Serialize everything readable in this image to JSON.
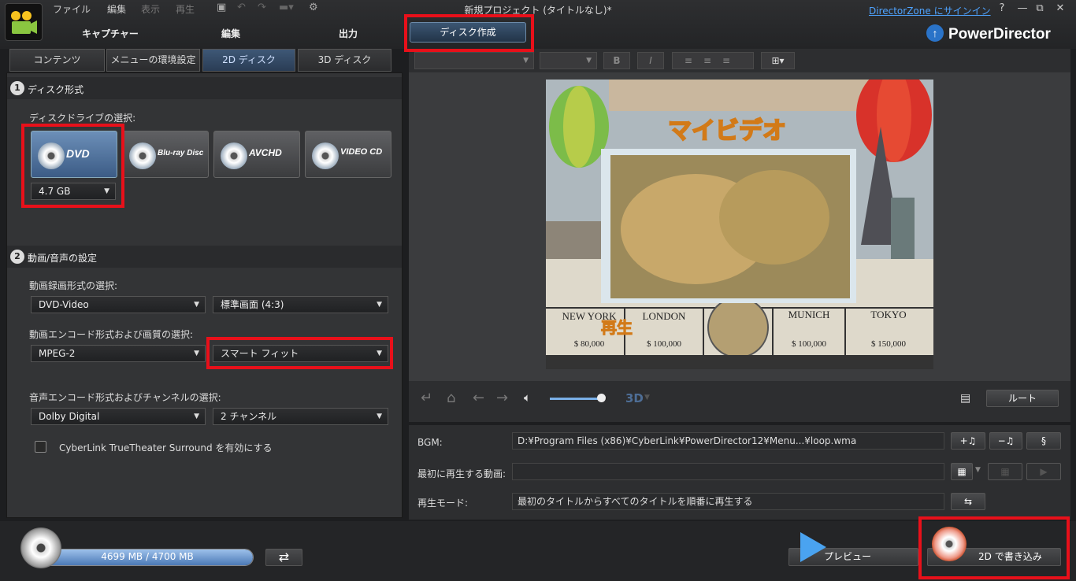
{
  "menu": {
    "file": "ファイル",
    "edit": "編集",
    "view": "表示",
    "play": "再生"
  },
  "window": {
    "title": "新規プロジェクト (タイトルなし)*",
    "signin": "DirectorZone にサインイン",
    "help": "?",
    "minimize": "—",
    "restore": "⧉",
    "close": "✕"
  },
  "modes": {
    "capture": "キャプチャー",
    "edit": "編集",
    "output": "出力",
    "disc": "ディスク作成"
  },
  "brand": "PowerDirector",
  "subtabs": [
    "コンテンツ",
    "メニューの環境設定",
    "2D ディスク",
    "3D ディスク"
  ],
  "section1": {
    "num": "1",
    "title": "ディスク形式",
    "drive_label": "ディスクドライブの選択:",
    "discs": [
      "DVD",
      "Blu-ray Disc",
      "AVCHD",
      "VIDEO CD"
    ],
    "size": "4.7 GB"
  },
  "section2": {
    "num": "2",
    "title": "動画/音声の設定",
    "rec_label": "動画録画形式の選択:",
    "rec_format": "DVD-Video",
    "aspect": "標準画面 (4:3)",
    "enc_label": "動画エンコード形式および画質の選択:",
    "enc_format": "MPEG-2",
    "quality": "スマート フィット",
    "audio_label": "音声エンコード形式およびチャンネルの選択:",
    "audio_format": "Dolby Digital",
    "channels": "2 チャンネル",
    "surround": "CyberLink TrueTheater Surround を有効にする",
    "surround_checked": false
  },
  "preview": {
    "menu_title": "マイビデオ",
    "play_button": "再生",
    "cities": [
      {
        "name": "NEW YORK",
        "price": "$ 80,000"
      },
      {
        "name": "LONDON",
        "price": "$ 100,000"
      },
      {
        "name": "MUNICH",
        "price": "$ 100,000"
      },
      {
        "name": "TOKYO",
        "price": "$ 150,000"
      }
    ],
    "volume": 0.9,
    "mode3d": "3D",
    "root_button": "ルート"
  },
  "bgm": {
    "bgm_label": "BGM:",
    "bgm_path": "D:¥Program Files (x86)¥CyberLink¥PowerDirector12¥Menu...¥loop.wma",
    "first_label": "最初に再生する動画:",
    "first_value": "",
    "mode_label": "再生モード:",
    "mode_value": "最初のタイトルからすべてのタイトルを順番に再生する"
  },
  "footer": {
    "capacity": "4699 MB / 4700 MB",
    "capacity_used": 0.9998,
    "preview": "プレビュー",
    "burn": "2D で書き込み"
  },
  "colors": {
    "accent": "#3c5c86",
    "highlight": "#e8101a",
    "link": "#4ea3ff"
  }
}
